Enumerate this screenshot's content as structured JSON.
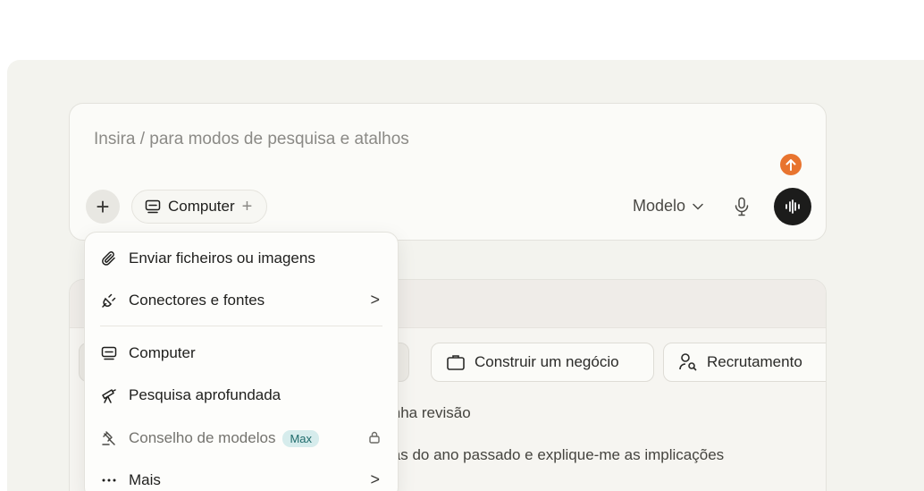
{
  "prompt": {
    "placeholder": "Insira / para modos de pesquisa e atalhos",
    "computer_chip_label": "Computer",
    "chip_add": "+",
    "add_button": "+",
    "model_label": "Modelo"
  },
  "menu": {
    "items": [
      {
        "label": "Enviar ficheiros ou imagens",
        "icon": "paperclip-icon"
      },
      {
        "label": "Conectores e fontes",
        "icon": "plug-icon",
        "chevron": ">"
      },
      {
        "label": "Computer",
        "icon": "computer-icon"
      },
      {
        "label": "Pesquisa aprofundada",
        "icon": "telescope-icon"
      },
      {
        "label": "Conselho de modelos",
        "icon": "gavel-icon",
        "badge": "Max",
        "locked": true
      },
      {
        "label": "Mais",
        "icon": "dots-icon",
        "chevron": ">"
      }
    ]
  },
  "background": {
    "chips": [
      "Construir um negócio",
      "Recrutamento"
    ],
    "line1": "inha revisão",
    "line2": "las do ano passado e explique-me as implicações"
  },
  "colors": {
    "accent_orange": "#e8742f",
    "max_badge_bg": "#d6ecec"
  }
}
